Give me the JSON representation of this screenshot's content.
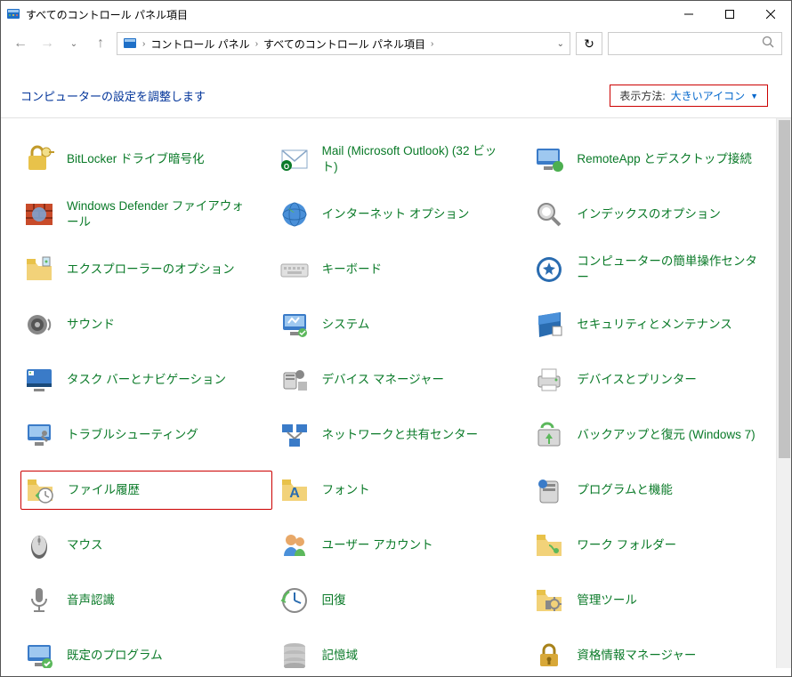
{
  "window": {
    "title": "すべてのコントロール パネル項目"
  },
  "breadcrumb": {
    "part1": "コントロール パネル",
    "part2": "すべてのコントロール パネル項目"
  },
  "header": {
    "title": "コンピューターの設定を調整します",
    "view_label": "表示方法:",
    "view_value": "大きいアイコン"
  },
  "items": [
    {
      "label": "BitLocker ドライブ暗号化",
      "icon": "bitlocker",
      "highlighted": false
    },
    {
      "label": "Mail (Microsoft Outlook) (32 ビット)",
      "icon": "mail",
      "highlighted": false
    },
    {
      "label": "RemoteApp とデスクトップ接続",
      "icon": "remoteapp",
      "highlighted": false
    },
    {
      "label": "Windows Defender ファイアウォール",
      "icon": "firewall",
      "highlighted": false
    },
    {
      "label": "インターネット オプション",
      "icon": "internet",
      "highlighted": false
    },
    {
      "label": "インデックスのオプション",
      "icon": "index",
      "highlighted": false
    },
    {
      "label": "エクスプローラーのオプション",
      "icon": "explorer-options",
      "highlighted": false
    },
    {
      "label": "キーボード",
      "icon": "keyboard",
      "highlighted": false
    },
    {
      "label": "コンピューターの簡単操作センター",
      "icon": "ease-of-access",
      "highlighted": false
    },
    {
      "label": "サウンド",
      "icon": "sound",
      "highlighted": false
    },
    {
      "label": "システム",
      "icon": "system",
      "highlighted": false
    },
    {
      "label": "セキュリティとメンテナンス",
      "icon": "security",
      "highlighted": false
    },
    {
      "label": "タスク バーとナビゲーション",
      "icon": "taskbar",
      "highlighted": false
    },
    {
      "label": "デバイス マネージャー",
      "icon": "device-manager",
      "highlighted": false
    },
    {
      "label": "デバイスとプリンター",
      "icon": "devices-printers",
      "highlighted": false
    },
    {
      "label": "トラブルシューティング",
      "icon": "troubleshoot",
      "highlighted": false
    },
    {
      "label": "ネットワークと共有センター",
      "icon": "network",
      "highlighted": false
    },
    {
      "label": "バックアップと復元 (Windows 7)",
      "icon": "backup",
      "highlighted": false
    },
    {
      "label": "ファイル履歴",
      "icon": "file-history",
      "highlighted": true
    },
    {
      "label": "フォント",
      "icon": "font",
      "highlighted": false
    },
    {
      "label": "プログラムと機能",
      "icon": "programs",
      "highlighted": false
    },
    {
      "label": "マウス",
      "icon": "mouse",
      "highlighted": false
    },
    {
      "label": "ユーザー アカウント",
      "icon": "users",
      "highlighted": false
    },
    {
      "label": "ワーク フォルダー",
      "icon": "work-folders",
      "highlighted": false
    },
    {
      "label": "音声認識",
      "icon": "speech",
      "highlighted": false
    },
    {
      "label": "回復",
      "icon": "recovery",
      "highlighted": false
    },
    {
      "label": "管理ツール",
      "icon": "admin-tools",
      "highlighted": false
    },
    {
      "label": "既定のプログラム",
      "icon": "default-programs",
      "highlighted": false
    },
    {
      "label": "記憶域",
      "icon": "storage",
      "highlighted": false
    },
    {
      "label": "資格情報マネージャー",
      "icon": "credentials",
      "highlighted": false
    }
  ]
}
